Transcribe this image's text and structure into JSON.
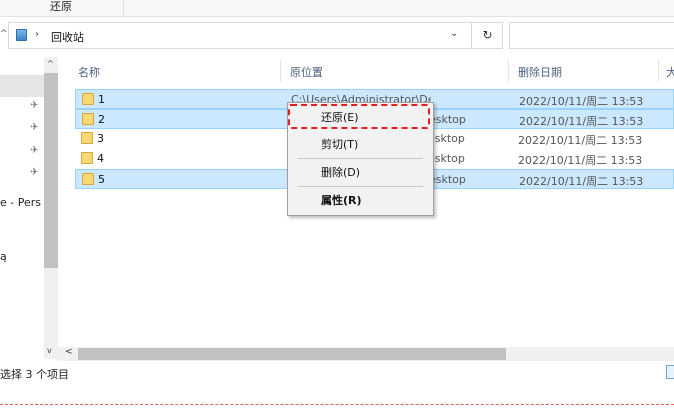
{
  "ribbon": {
    "tab_label": "还原"
  },
  "address": {
    "breadcrumb": "回收站",
    "separator": "›",
    "dropdown": "⌄",
    "refresh": "↻",
    "up": "^",
    "search_placeholder": ""
  },
  "nav_pane": {
    "items": [
      {
        "text": "e - Pers"
      },
      {
        "text": "ą"
      }
    ],
    "pin_glyph": "✈"
  },
  "columns": {
    "name": "名称",
    "location": "原位置",
    "date": "删除日期",
    "size": "大"
  },
  "rows": [
    {
      "name": "1",
      "location": "C:\\Users\\Administrator\\Desktop",
      "date": "2022/10/11/周二 13:53",
      "selected": true
    },
    {
      "name": "2",
      "location": "esktop",
      "date": "2022/10/11/周二 13:53",
      "selected": true
    },
    {
      "name": "3",
      "location": "esktop",
      "date": "2022/10/11/周二 13:53",
      "selected": false
    },
    {
      "name": "4",
      "location": "esktop",
      "date": "2022/10/11/周二 13:53",
      "selected": false
    },
    {
      "name": "5",
      "location": "esktop",
      "date": "2022/10/11/周二 13:53",
      "selected": true
    }
  ],
  "context_menu": {
    "restore": "还原(E)",
    "cut": "剪切(T)",
    "delete": "删除(D)",
    "properties": "属性(R)"
  },
  "status": {
    "text": "选择 3 个项目"
  },
  "scroll": {
    "up": "^",
    "down": "v",
    "left": "<"
  },
  "colors": {
    "selection": "#cce8ff",
    "highlight": "#e02020"
  }
}
